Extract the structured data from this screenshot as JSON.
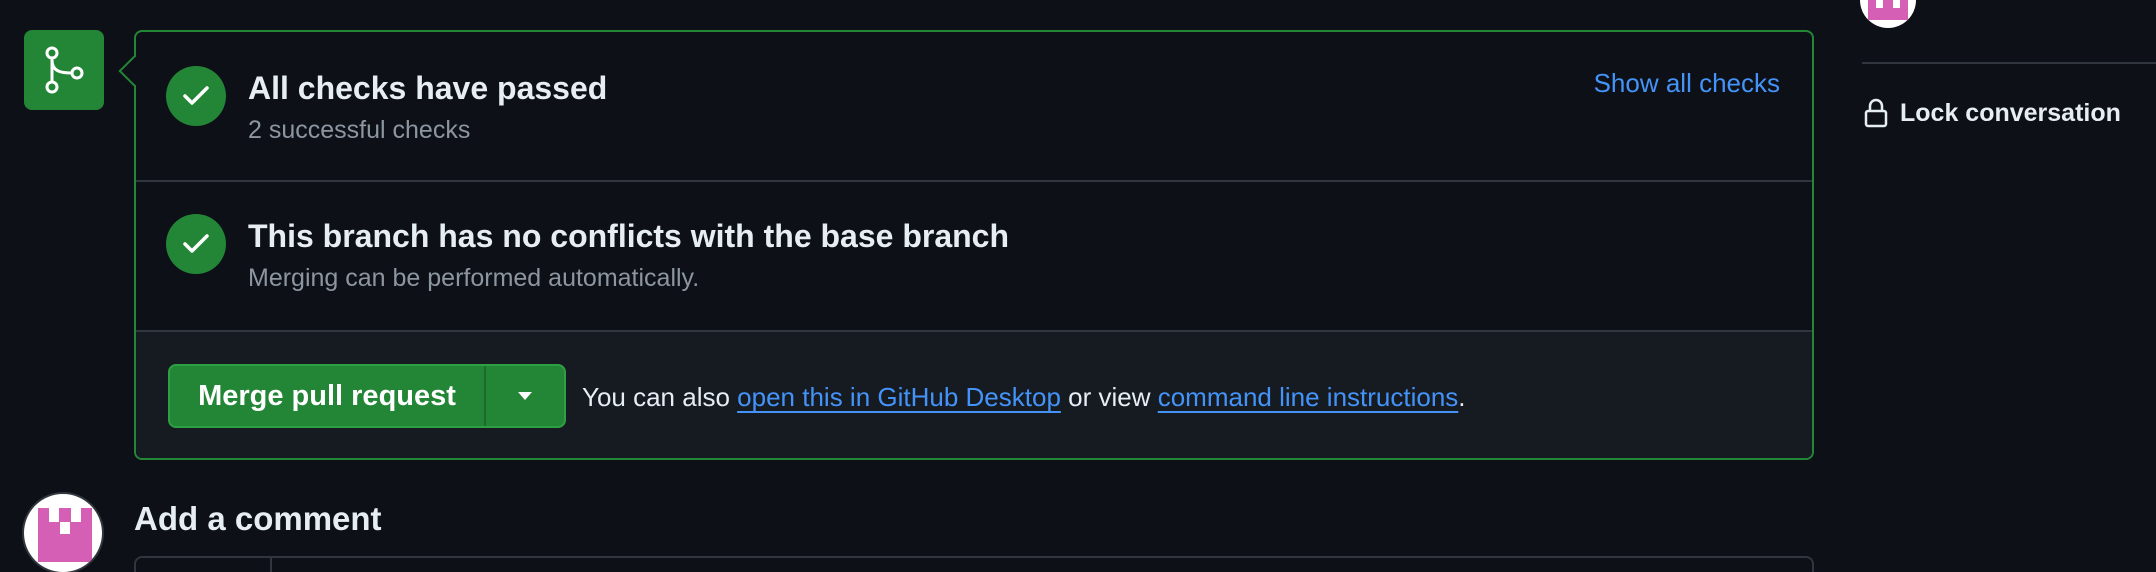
{
  "colors": {
    "background": "#0d1117",
    "success": "#238636",
    "link": "#4493f8",
    "muted": "#8d96a0",
    "border": "#30363d"
  },
  "icons": {
    "timeline": "git-merge-icon",
    "check": "check-icon",
    "dropdown": "triangle-down-icon",
    "lock": "lock-icon",
    "avatar": "identicon-avatar"
  },
  "checks": {
    "title": "All checks have passed",
    "subtitle": "2 successful checks",
    "show_all_label": "Show all checks"
  },
  "conflicts": {
    "title": "This branch has no conflicts with the base branch",
    "subtitle": "Merging can be performed automatically."
  },
  "merge": {
    "button_label": "Merge pull request",
    "help_prefix": "You can also ",
    "desktop_link": "open this in GitHub Desktop",
    "help_middle": " or view ",
    "cli_link": "command line instructions",
    "help_suffix": "."
  },
  "comment": {
    "heading": "Add a comment"
  },
  "sidebar": {
    "lock_label": "Lock conversation"
  }
}
